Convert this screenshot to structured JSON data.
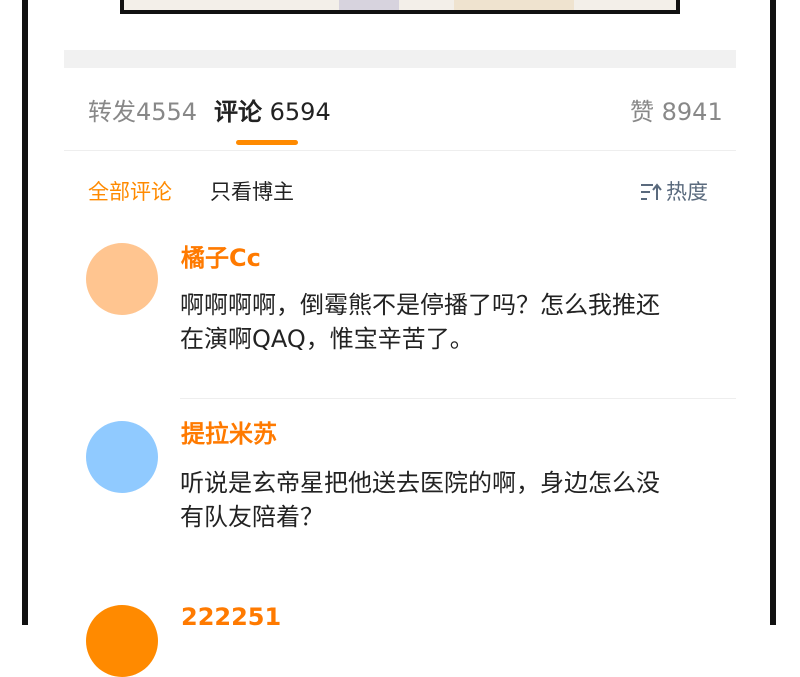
{
  "tabs": {
    "forward": {
      "label": "转发",
      "count": "4554"
    },
    "comments": {
      "label": "评论",
      "count": "6594"
    },
    "likes": {
      "label": "赞",
      "count": "8941"
    }
  },
  "filters": {
    "all": "全部评论",
    "blogger_only": "只看博主",
    "sort": {
      "icon": "sort-icon",
      "label": "热度"
    }
  },
  "comments": [
    {
      "username": "橘子Cc",
      "text": "啊啊啊啊，倒霉熊不是停播了吗？怎么我推还在演啊QAQ，惟宝辛苦了。",
      "avatar_color": "#ffc590",
      "name_color": "#ff7a00"
    },
    {
      "username": "提拉米苏",
      "text": "听说是玄帝星把他送去医院的啊，身边怎么没有队友陪着？",
      "avatar_color": "#90caff",
      "name_color": "#ff7a00"
    },
    {
      "username": "222251",
      "text": "",
      "avatar_color": "#ff8a00",
      "name_color": "#ff7a00"
    }
  ],
  "colors": {
    "accent": "#ff8a00",
    "frame": "#111111"
  }
}
